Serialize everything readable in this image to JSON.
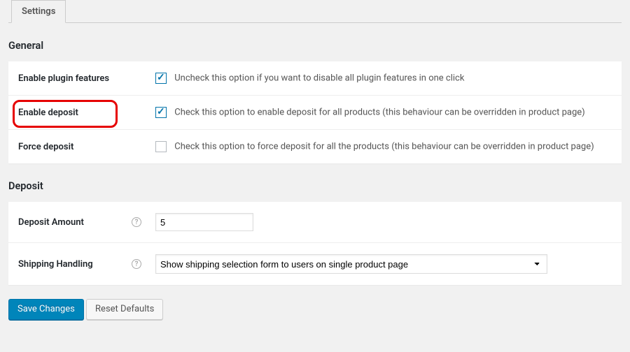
{
  "tabs": {
    "settings": "Settings"
  },
  "sections": {
    "general": {
      "title": "General",
      "rows": {
        "enable_plugin": {
          "label": "Enable plugin features",
          "description": "Uncheck this option if you want to disable all plugin features in one click",
          "checked": true
        },
        "enable_deposit": {
          "label": "Enable deposit",
          "description": "Check this option to enable deposit for all products (this behaviour can be overridden in product page)",
          "checked": true,
          "highlighted": true
        },
        "force_deposit": {
          "label": "Force deposit",
          "description": "Check this option to force deposit for all the products (this behaviour can be overridden in product page)",
          "checked": false
        }
      }
    },
    "deposit": {
      "title": "Deposit",
      "rows": {
        "amount": {
          "label": "Deposit Amount",
          "value": "5"
        },
        "shipping": {
          "label": "Shipping Handling",
          "selected": "Show shipping selection form to users on single product page"
        }
      }
    }
  },
  "help_glyph": "?",
  "buttons": {
    "save": "Save Changes",
    "reset": "Reset Defaults"
  }
}
